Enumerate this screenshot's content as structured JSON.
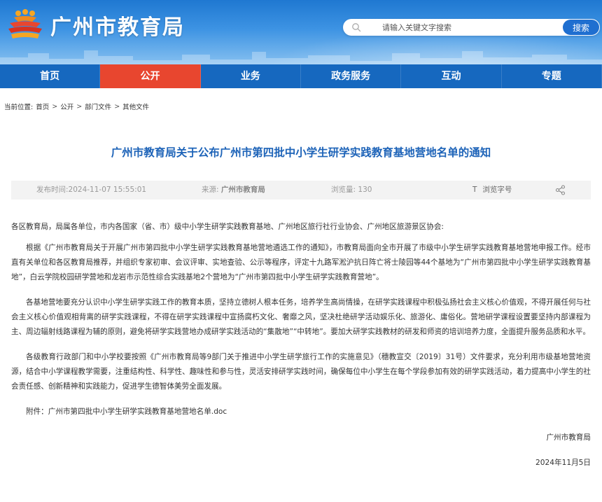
{
  "header": {
    "site_title": "广州市教育局",
    "logo_icon": "education-bureau-emblem-icon",
    "search": {
      "placeholder": "请输入关键文字搜索",
      "button_label": "搜索",
      "icon": "search-icon"
    },
    "colors": {
      "header_blue": "#2a82d8",
      "nav_blue": "#1668bf",
      "active_red": "#e8462f"
    }
  },
  "nav": {
    "items": [
      {
        "label": "首页"
      },
      {
        "label": "公开"
      },
      {
        "label": "业务"
      },
      {
        "label": "政务服务"
      },
      {
        "label": "互动"
      },
      {
        "label": "专题"
      }
    ],
    "active": "公开"
  },
  "breadcrumb": {
    "prefix": "当前位置:",
    "items": [
      "首页",
      "公开",
      "部门文件",
      "其他文件"
    ],
    "separator": ">"
  },
  "article": {
    "title": "广州市教育局关于公布广州市第四批中小学生研学实践教育基地营地名单的通知",
    "meta": {
      "date": "发布时间:2024-11-07 15:55:01",
      "source_label": "来源:",
      "source_value": "广州市教育局",
      "views_label": "浏览量:",
      "views_value": "130",
      "font_icon_text": "T",
      "font_label": "浏览字号",
      "share_icon": "share-icon"
    },
    "salutation": "各区教育局，局属各单位，市内各国家（省、市）级中小学生研学实践教育基地、广州地区旅行社行业协会、广州地区旅游景区协会:",
    "paragraphs": [
      "根据《广州市教育局关于开展广州市第四批中小学生研学实践教育基地营地遴选工作的通知》，市教育局面向全市开展了市级中小学生研学实践教育基地营地申报工作。经市直有关单位和各区教育局推荐，并组织专家初审、会议评审、实地查验、公示等程序，评定十九路军淞沪抗日阵亡将士陵园等44个基地为“广州市第四批中小学生研学实践教育基地”，白云学院校园研学营地和龙岩市示范性综合实践基地2个营地为“广州市第四批中小学生研学实践教育营地”。",
      "各基地营地要充分认识中小学生研学实践工作的教育本质，坚持立德树人根本任务，培养学生高尚情操，在研学实践课程中积极弘扬社会主义核心价值观，不得开展任何与社会主义核心价值观相背离的研学实践课程，不得在研学实践课程中宣扬腐朽文化、奢靡之风，坚决杜绝研学活动娱乐化、旅游化、庸俗化。营地研学课程设置要坚持内部课程为主、周边辐射线路课程为辅的原则，避免将研学实践营地办成研学实践活动的“集散地”“中转地”。要加大研学实践教材的研发和师资的培训培养力度，全面提升服务品质和水平。",
      "各级教育行政部门和中小学校要按照《广州市教育局等9部门关于推进中小学生研学旅行工作的实施意见》（穗教宣交〔2019〕31号）文件要求，充分利用市级基地营地资源，结合中小学课程教学需要，注重结构性、科学性、趣味性和参与性，灵活安排研学实践时间，确保每位中小学生在每个学段参加有效的研学实践活动，着力提高中小学生的社会责任感、创新精神和实践能力，促进学生德智体美劳全面发展。"
    ],
    "attachment": "附件：广州市第四批中小学生研学实践教育基地营地名单.doc",
    "signature": "广州市教育局",
    "sign_date": "2024年11月5日"
  }
}
